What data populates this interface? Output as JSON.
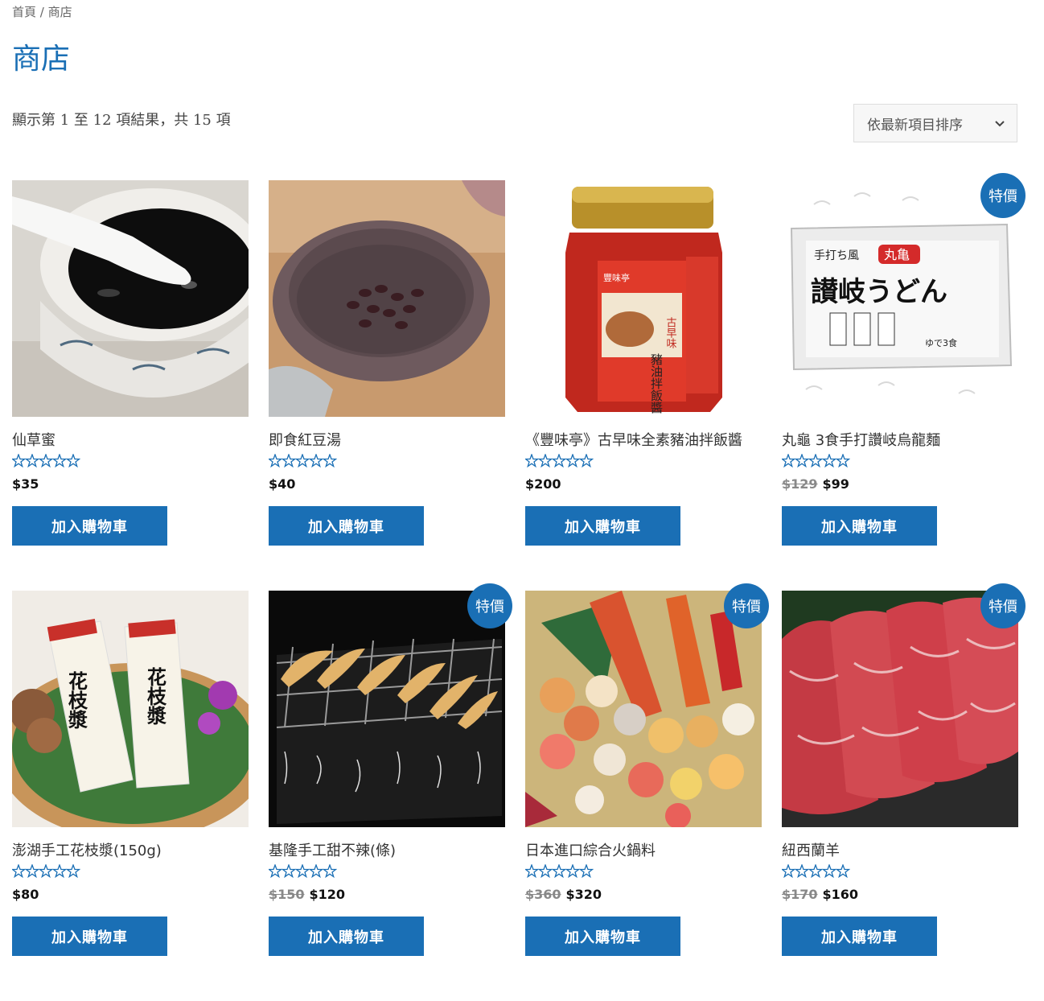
{
  "breadcrumb": {
    "home": "首頁",
    "separator": "/",
    "current": "商店"
  },
  "page_title": "商店",
  "result_count": "顯示第 1 至 12 項結果，共 15 項",
  "ordering": {
    "selected": "依最新項目排序"
  },
  "colors": {
    "accent": "#1a6fb5"
  },
  "button_label": "加入購物車",
  "sale_badge": "特價",
  "products": [
    {
      "name": "仙草蜜",
      "rating": 0,
      "price": "$35",
      "regular_price": ""
    },
    {
      "name": "即食紅豆湯",
      "rating": 0,
      "price": "$40",
      "regular_price": ""
    },
    {
      "name": "《豐味亭》古早味全素豬油拌飯醬",
      "rating": 0,
      "price": "$200",
      "regular_price": ""
    },
    {
      "name": "丸龜 3食手打讚岐烏龍麵",
      "rating": 0,
      "price": "$99",
      "regular_price": "$129",
      "on_sale": true
    },
    {
      "name": "澎湖手工花枝漿(150g)",
      "rating": 0,
      "price": "$80",
      "regular_price": ""
    },
    {
      "name": "基隆手工甜不辣(條)",
      "rating": 0,
      "price": "$120",
      "regular_price": "$150",
      "on_sale": true
    },
    {
      "name": "日本進口綜合火鍋料",
      "rating": 0,
      "price": "$320",
      "regular_price": "$360",
      "on_sale": true
    },
    {
      "name": "紐西蘭羊",
      "rating": 0,
      "price": "$160",
      "regular_price": "$170",
      "on_sale": true
    }
  ],
  "product_images": {
    "jar_brand": "豐味亭",
    "jar_label": "豬油拌飯醬",
    "jar_side": "古早味",
    "udon_title": "讃岐うどん",
    "udon_brand": "丸亀",
    "udon_top": "手打ち風",
    "udon_note": "ゆで3食",
    "squid_label": "花枝漿"
  }
}
